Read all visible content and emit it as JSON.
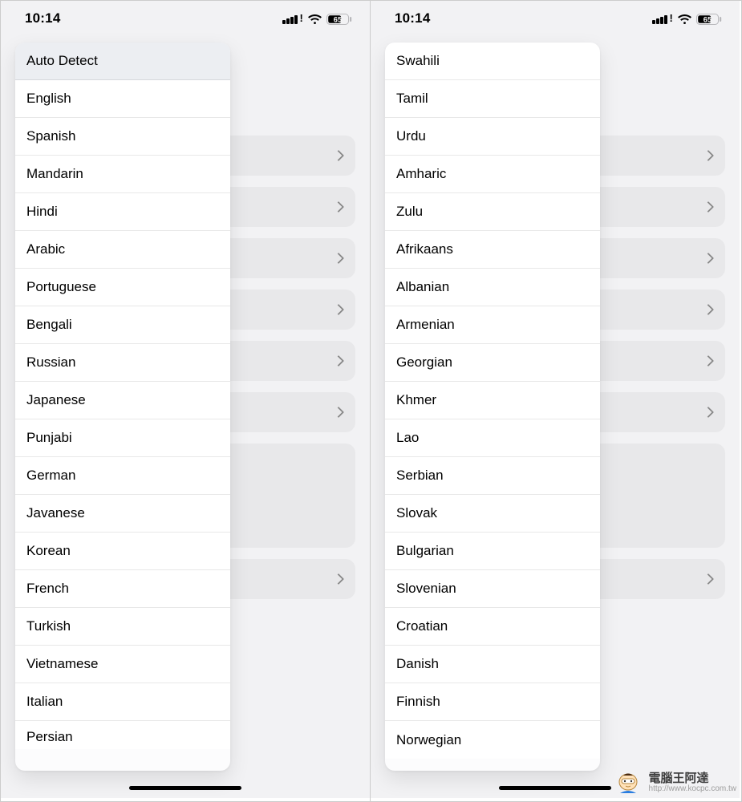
{
  "status": {
    "time": "10:14",
    "battery": "65"
  },
  "left": {
    "selected_index": 0,
    "languages": [
      "Auto Detect",
      "English",
      "Spanish",
      "Mandarin",
      "Hindi",
      "Arabic",
      "Portuguese",
      "Bengali",
      "Russian",
      "Japanese",
      "Punjabi",
      "German",
      "Javanese",
      "Korean",
      "French",
      "Turkish",
      "Vietnamese",
      "Italian",
      "Persian"
    ]
  },
  "right": {
    "selected_index": -1,
    "languages": [
      "Swahili",
      "Tamil",
      "Urdu",
      "Amharic",
      "Zulu",
      "Afrikaans",
      "Albanian",
      "Armenian",
      "Georgian",
      "Khmer",
      "Lao",
      "Serbian",
      "Slovak",
      "Bulgarian",
      "Slovenian",
      "Croatian",
      "Danish",
      "Finnish",
      "Norwegian"
    ]
  },
  "watermark": {
    "title": "電腦王阿達",
    "url": "http://www.kocpc.com.tw"
  }
}
